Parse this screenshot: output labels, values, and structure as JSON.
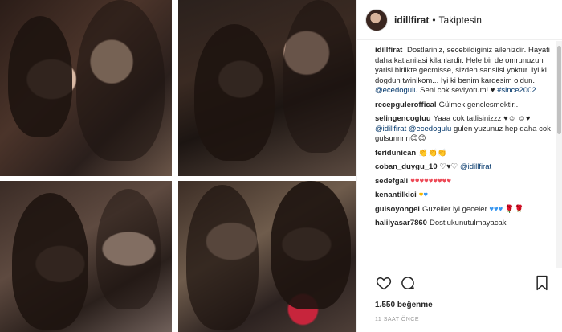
{
  "header": {
    "username": "idillfirat",
    "separator": "•",
    "follow_status": "Takiptesin"
  },
  "caption": {
    "username": "idillfirat",
    "text_1": "Dostlariniz, secebildiginiz ailenizdir. Hayati daha katlanilasi kilanlardir. Hele bir de omrunuzun yarisi birlikte gecmisse, sizden sanslisi yoktur. Iyi ki dogdun twinikom... Iyi ki benim kardesim oldun.",
    "mention": "@ecedogulu",
    "text_2": "Seni cok seviyorum! ♥",
    "hashtag": "#since2002"
  },
  "comments": [
    {
      "username": "recepguleroffical",
      "parts": [
        {
          "t": "Gülmek genclesmektir..",
          "k": "text"
        }
      ]
    },
    {
      "username": "selingencogluu",
      "parts": [
        {
          "t": "Yaaa cok tatlisinizzz ♥☺ ☺♥ ",
          "k": "text"
        },
        {
          "t": "@idillfirat @ecedogulu",
          "k": "link"
        },
        {
          "t": " gulen yuzunuz hep daha cok gulsunnnn😍😍",
          "k": "text"
        }
      ]
    },
    {
      "username": "feridunican",
      "parts": [
        {
          "t": "👏👏👏",
          "k": "text"
        }
      ]
    },
    {
      "username": "coban_duygu_10",
      "parts": [
        {
          "t": "♡♥♡ ",
          "k": "text"
        },
        {
          "t": "@idillfirat",
          "k": "link"
        }
      ]
    },
    {
      "username": "sedefgali",
      "parts": [
        {
          "t": "♥♥♥♥♥♥♥♥♥",
          "k": "heart"
        }
      ]
    },
    {
      "username": "kenantilkici",
      "parts": [
        {
          "t": "♥",
          "k": "yellow"
        },
        {
          "t": "♥",
          "k": "blue"
        }
      ]
    },
    {
      "username": "gulsoyongel",
      "parts": [
        {
          "t": "Guzeller iyi geceler ",
          "k": "text"
        },
        {
          "t": "♥♥♥",
          "k": "blue"
        },
        {
          "t": " 🌹🌹",
          "k": "text"
        }
      ]
    },
    {
      "username": "halilyasar7860",
      "parts": [
        {
          "t": "Dostlukunutulmayacak",
          "k": "text"
        }
      ]
    }
  ],
  "actions": {
    "like_icon": "heart-outline-icon",
    "comment_icon": "speech-bubble-icon",
    "save_icon": "bookmark-icon"
  },
  "likes": {
    "count": "1.550",
    "label": "beğenme"
  },
  "timestamp": "11 SAAT ÖNCE",
  "colors": {
    "link": "#003569",
    "muted": "#999999",
    "heart": "#ed4956",
    "blue": "#3897f0",
    "yellow": "#f5b700"
  }
}
